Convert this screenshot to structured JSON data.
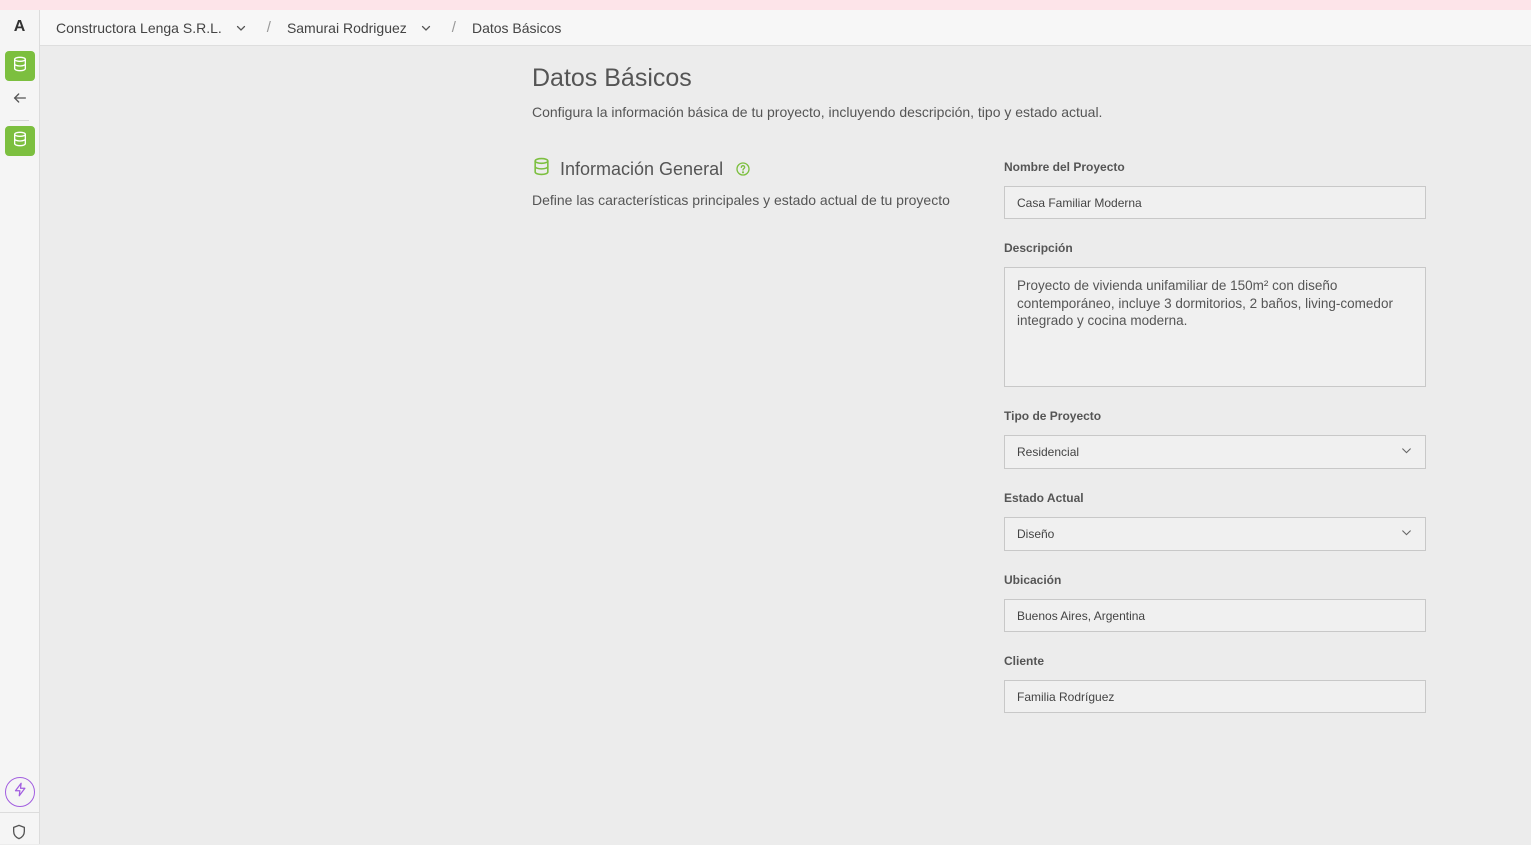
{
  "sidebar": {
    "logo": "A",
    "icons": [
      "database-icon",
      "arrow-left-icon",
      "database-icon",
      "bolt-icon",
      "shield-icon"
    ],
    "accent_color": "#7cbf3f",
    "bolt_color": "#a25ee0"
  },
  "breadcrumb": {
    "company": "Constructora Lenga S.R.L.",
    "separator": "/",
    "user": "Samurai Rodriguez",
    "current": "Datos Básicos"
  },
  "page": {
    "title": "Datos Básicos",
    "description": "Configura la información básica de tu proyecto, incluyendo descripción, tipo y estado actual."
  },
  "section": {
    "title": "Información General",
    "description": "Define las características principales y estado actual de tu proyecto"
  },
  "form": {
    "name_label": "Nombre del Proyecto",
    "name_value": "Casa Familiar Moderna",
    "description_label": "Descripción",
    "description_value": "Proyecto de vivienda unifamiliar de 150m² con diseño contemporáneo, incluye 3 dormitorios, 2 baños, living-comedor integrado y cocina moderna.",
    "type_label": "Tipo de Proyecto",
    "type_value": "Residencial",
    "status_label": "Estado Actual",
    "status_value": "Diseño",
    "location_label": "Ubicación",
    "location_value": "Buenos Aires, Argentina",
    "client_label": "Cliente",
    "client_value": "Familia Rodríguez"
  }
}
